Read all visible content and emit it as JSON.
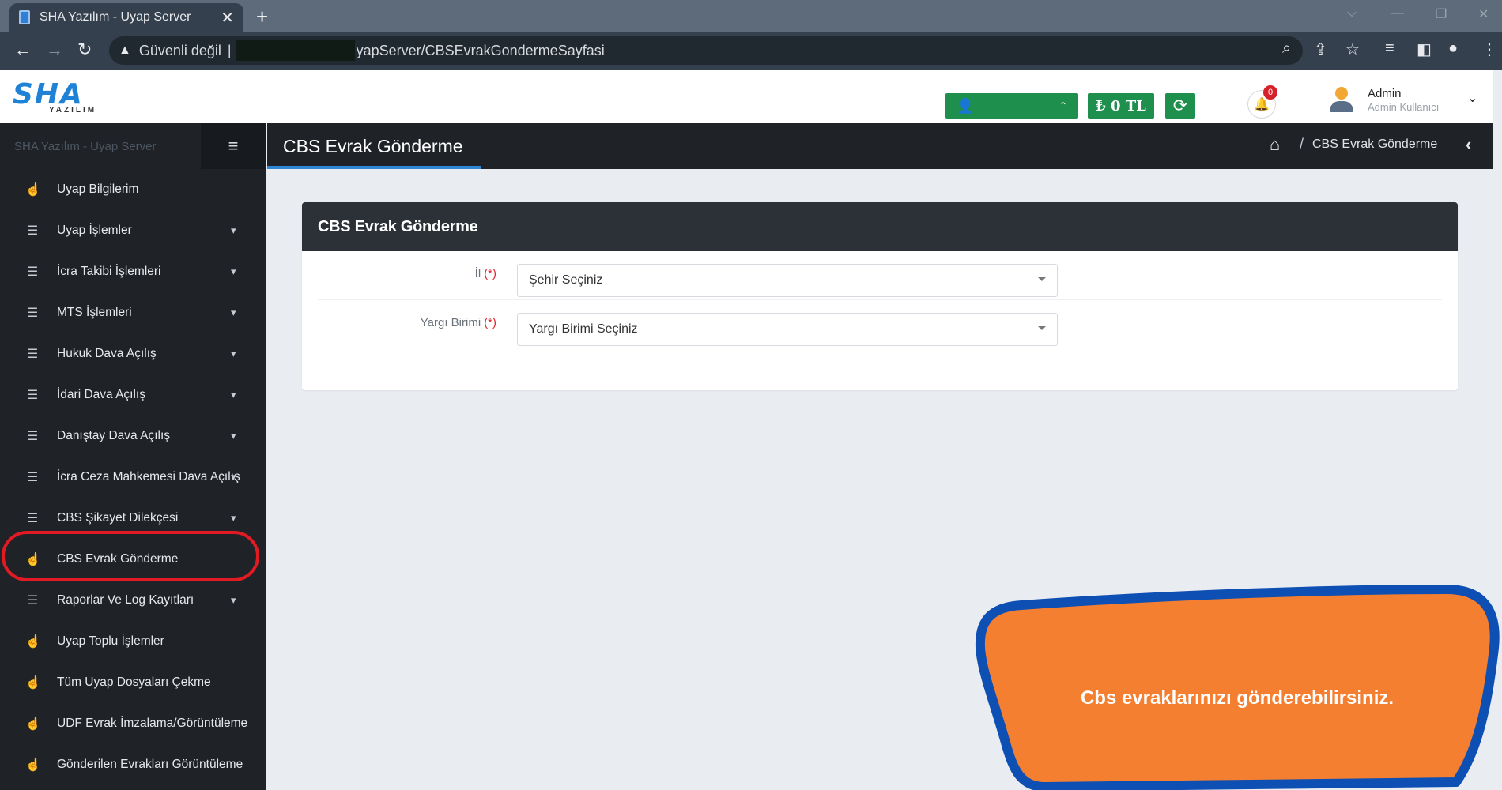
{
  "browser": {
    "tab_title": "SHA Yazılım - Uyap Server",
    "address_warning": "Güvenli değil",
    "address_sep": "|",
    "address_url": "yapServer/CBSEvrakGondermeSayfasi"
  },
  "header": {
    "logo_text": "SHA",
    "logo_subtext": "YAZILIM",
    "balance": "₺ 0 TL",
    "notification_count": "0",
    "user_name": "Admin",
    "user_role": "Admin Kullanıcı"
  },
  "sidebar": {
    "brand": "SHA Yazılım - Uyap Server",
    "items": [
      {
        "label": "Uyap Bilgilerim"
      },
      {
        "label": "Uyap İşlemler"
      },
      {
        "label": "İcra Takibi İşlemleri"
      },
      {
        "label": "MTS İşlemleri"
      },
      {
        "label": "Hukuk Dava Açılış"
      },
      {
        "label": "İdari Dava Açılış"
      },
      {
        "label": "Danıştay Dava Açılış"
      },
      {
        "label": "İcra Ceza Mahkemesi Dava Açılış"
      },
      {
        "label": "CBS Şikayet Dilekçesi"
      },
      {
        "label": "CBS Evrak Gönderme"
      },
      {
        "label": "Raporlar Ve Log Kayıtları"
      },
      {
        "label": "Uyap Toplu İşlemler"
      },
      {
        "label": "Tüm Uyap Dosyaları Çekme"
      },
      {
        "label": "UDF Evrak İmzalama/Görüntüleme"
      },
      {
        "label": "Gönderilen Evrakları Görüntüleme"
      }
    ]
  },
  "page": {
    "title": "CBS Evrak Gönderme",
    "breadcrumb_sep": "/",
    "breadcrumb_current": "CBS Evrak Gönderme"
  },
  "form": {
    "card_title": "CBS Evrak Gönderme",
    "required_mark": "(*)",
    "il_label": "İl",
    "il_value": "Şehir Seçiniz",
    "yargi_label": "Yargı Birimi",
    "yargi_value": "Yargı Birimi Seçiniz"
  },
  "callout": {
    "text": "Cbs evraklarınızı gönderebilirsiniz."
  },
  "colors": {
    "accent_green": "#1f8f4d",
    "callout_fill": "#f47f31",
    "callout_border": "#0d4fb3",
    "highlight_red": "#e01b24"
  }
}
